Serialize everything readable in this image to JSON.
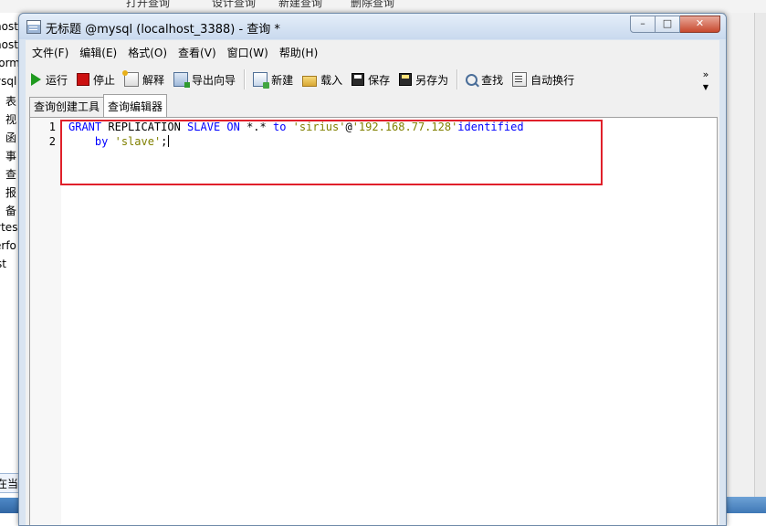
{
  "background": {
    "toolbar_items": [
      "打开查询",
      "设计查询",
      "新建查询",
      "删除查询"
    ],
    "tree_items": [
      "host",
      "host",
      "form",
      "ysql",
      "表",
      "视",
      "函",
      "事",
      "查",
      "报",
      "备",
      "ytes",
      "erfo",
      "st"
    ],
    "status_text": "在当前"
  },
  "window": {
    "title": "无标题 @mysql (localhost_3388) - 查询 *",
    "minimize": "–",
    "maximize": "□",
    "close": "✕"
  },
  "menu": {
    "items": [
      "文件(F)",
      "编辑(E)",
      "格式(O)",
      "查看(V)",
      "窗口(W)",
      "帮助(H)"
    ]
  },
  "toolbar": {
    "run": "运行",
    "stop": "停止",
    "explain": "解释",
    "export_wizard": "导出向导",
    "new": "新建",
    "load": "载入",
    "save": "保存",
    "save_as": "另存为",
    "find": "查找",
    "auto_wrap": "自动换行",
    "more": "»"
  },
  "tabs": [
    "查询创建工具",
    "查询编辑器"
  ],
  "editor": {
    "line_numbers": [
      "1",
      "2"
    ],
    "line1": {
      "k1": "GRANT",
      "t1": " REPLICATION ",
      "k2": "SLAVE",
      "t2": " ",
      "k3": "ON",
      "t3": " *.* ",
      "k4": "to",
      "t4": " ",
      "s1": "'sirius'",
      "t5": "@",
      "s2": "'192.168.77.128'",
      "k5": "identified"
    },
    "line2": {
      "indent": "    ",
      "k1": "by",
      "t1": " ",
      "s1": "'slave'",
      "t2": ";"
    }
  }
}
